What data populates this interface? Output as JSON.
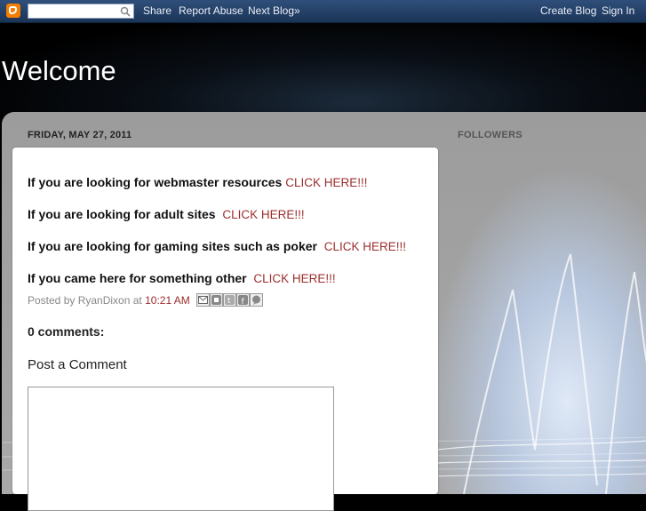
{
  "navbar": {
    "search_placeholder": "",
    "links": [
      {
        "label": "Share"
      },
      {
        "label": "Report Abuse"
      },
      {
        "label": "Next Blog»"
      }
    ],
    "create_blog": "Create Blog",
    "sign_in": "Sign In"
  },
  "header": {
    "title": "Welcome"
  },
  "post": {
    "date": "FRIDAY, MAY 27, 2011",
    "lines": [
      {
        "text": "If you are looking for webmaster resources",
        "link": "CLICK HERE!!!"
      },
      {
        "text": "If you are looking for adult sites",
        "link": "CLICK HERE!!!"
      },
      {
        "text": "If you are looking for gaming sites such as poker",
        "link": "CLICK HERE!!!"
      },
      {
        "text": "If you came here for something other",
        "link": "CLICK HERE!!!"
      }
    ],
    "byline_prefix": "Posted by RyanDixon at",
    "time": "10:21 AM",
    "comments_count": "0 comments:",
    "post_comment": "Post a Comment"
  },
  "sidebar": {
    "followers_title": "FOLLOWERS"
  },
  "colors": {
    "link": "#9c2d2d",
    "navbar": "#2f4f7a",
    "logo": "#f57d00"
  }
}
